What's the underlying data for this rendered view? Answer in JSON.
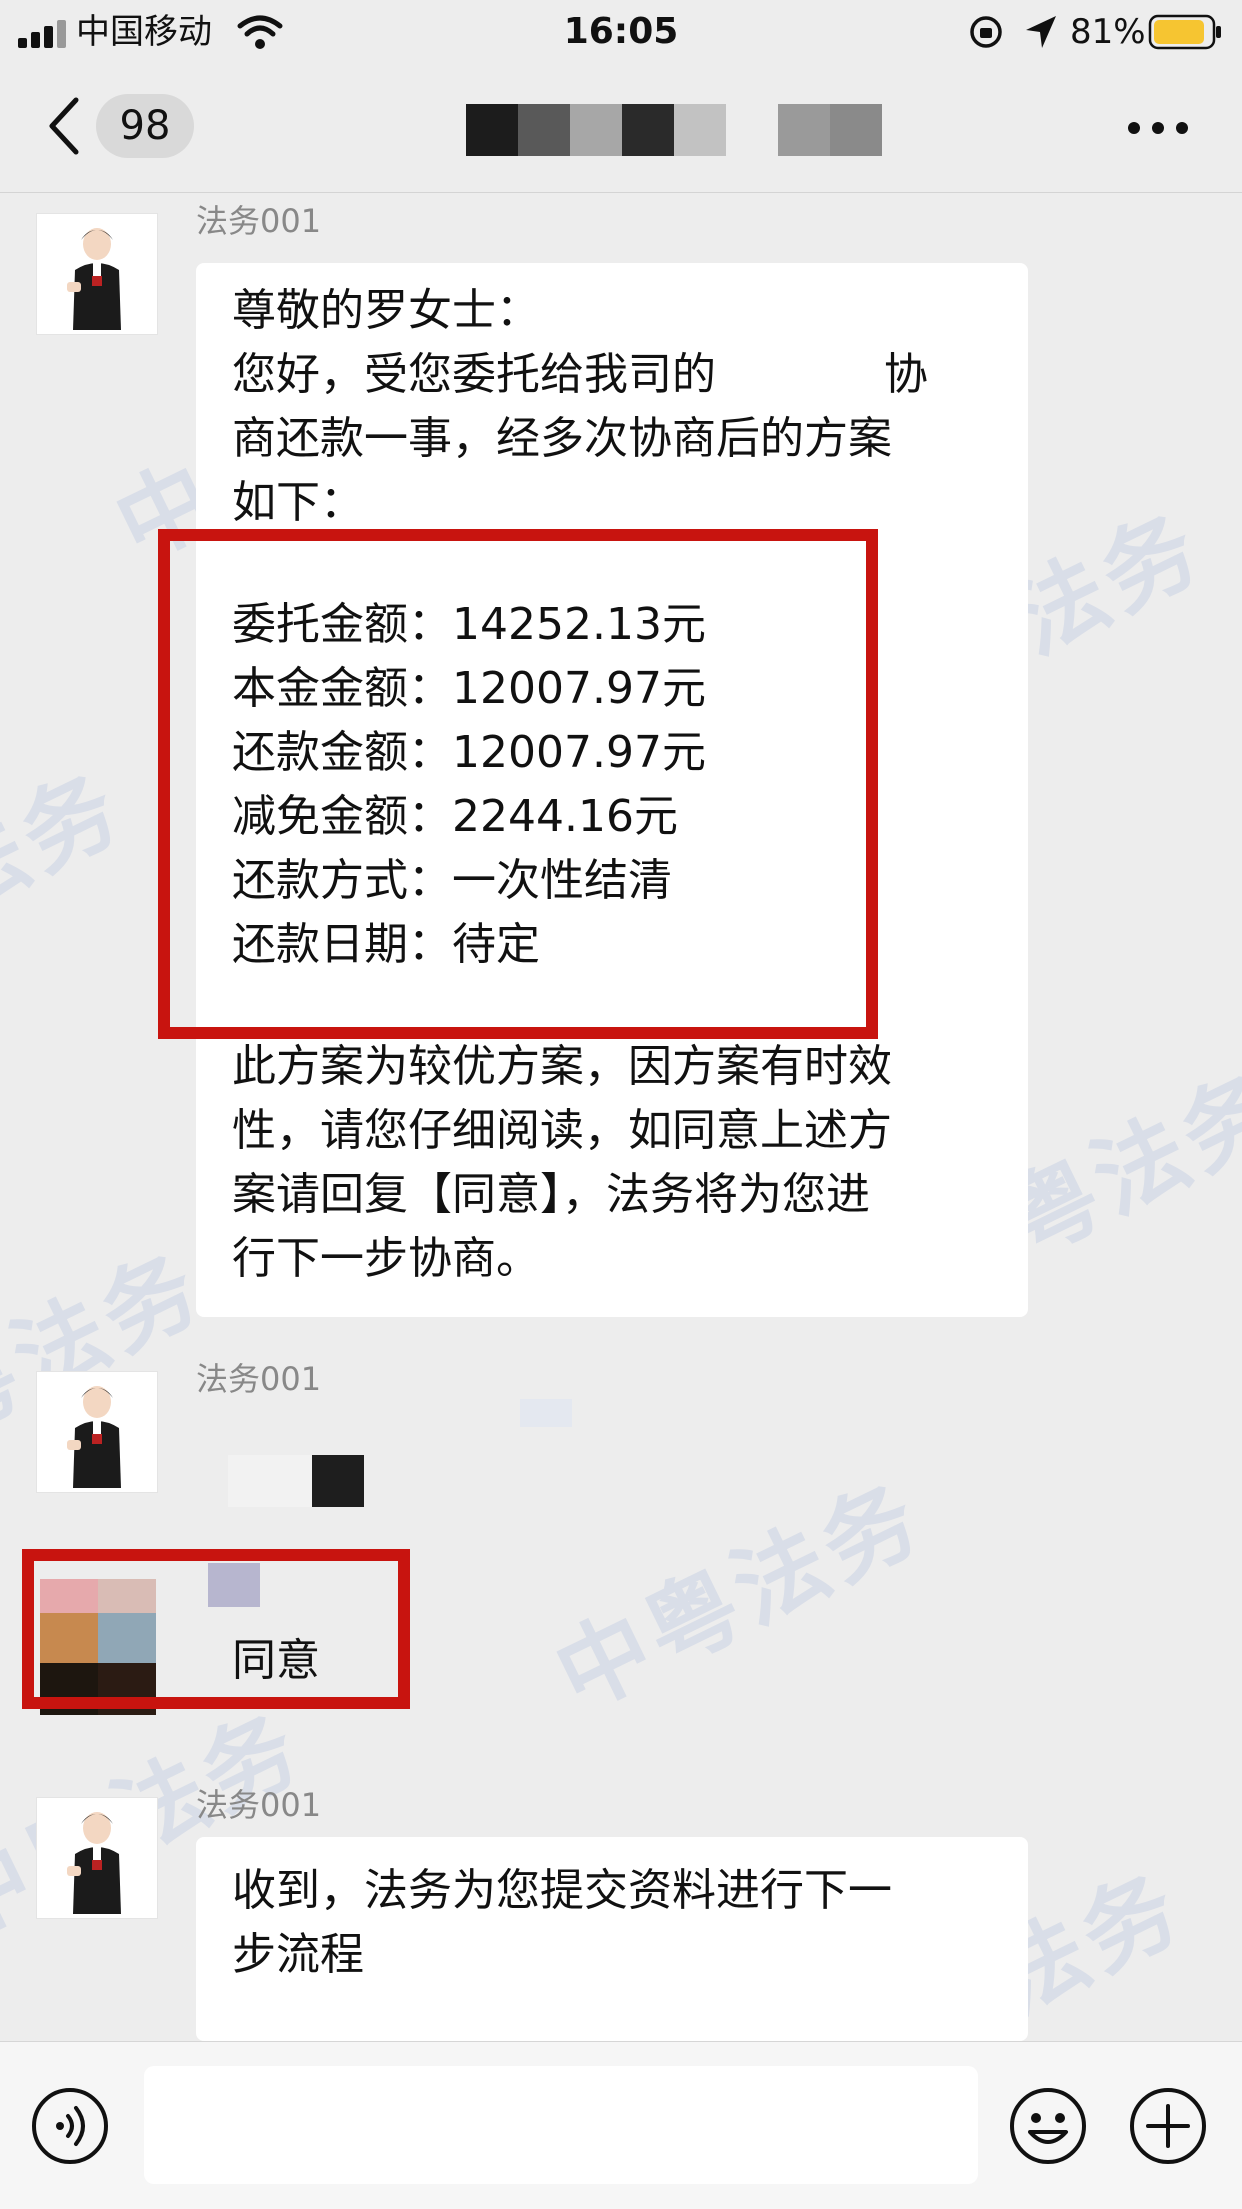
{
  "status_bar": {
    "carrier": "中国移动",
    "time": "16:05",
    "battery_percent": "81%"
  },
  "nav": {
    "unread_count": "98",
    "more_icon": "more-dots-icon"
  },
  "watermark": "中粤法务",
  "messages": [
    {
      "sender": "法务001",
      "lines_top": "尊敬的罗女士：\n您好，受您委托给我司的            协\n商还款一事，经多次协商后的方案\n如下：",
      "details": "委托金额：14252.13元\n本金金额：12007.97元\n还款金额：12007.97元\n减免金额：2244.16元\n还款方式：一次性结清\n还款日期：待定",
      "lines_bottom": "此方案为较优方案，因方案有时效\n性，请您仔细阅读，如同意上述方\n案请回复【同意】，法务将为您进\n行下一步协商。"
    },
    {
      "sender": "法务001"
    },
    {
      "text": "同意"
    },
    {
      "sender": "法务001",
      "text": "收到，法务为您提交资料进行下一\n步流程"
    }
  ],
  "icons": {
    "voice": "voice-icon",
    "emoji": "emoji-icon",
    "plus": "plus-icon"
  }
}
